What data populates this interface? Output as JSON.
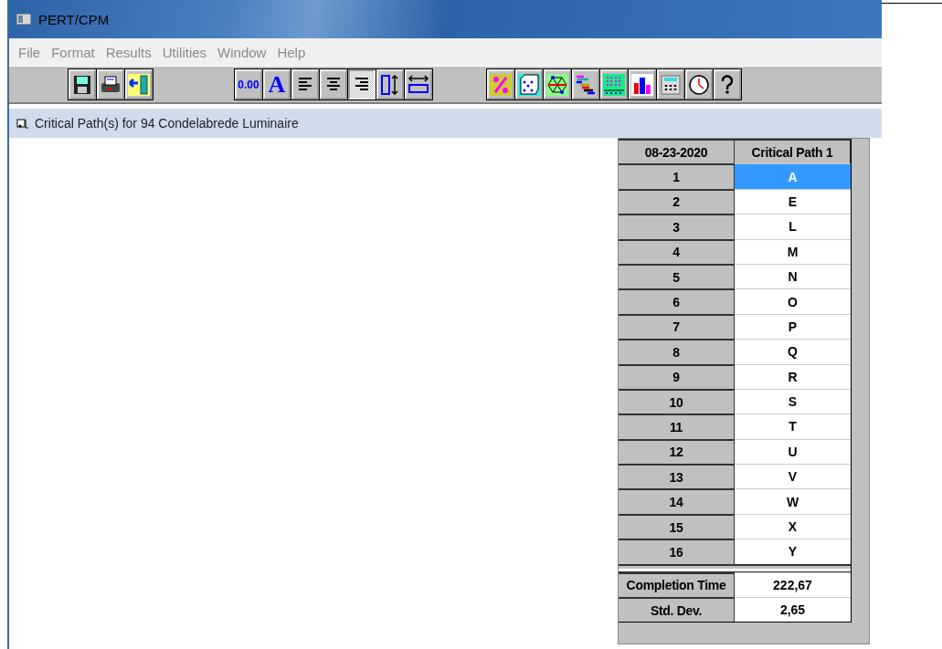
{
  "window": {
    "title": "PERT/CPM"
  },
  "menu": [
    {
      "label": "File"
    },
    {
      "label": "Format"
    },
    {
      "label": "Results"
    },
    {
      "label": "Utilities"
    },
    {
      "label": "Window"
    },
    {
      "label": "Help"
    }
  ],
  "toolbar": [
    [
      {
        "kind": "save",
        "pressed": false
      },
      {
        "kind": "print",
        "pressed": false
      },
      {
        "kind": "exit",
        "pressed": false
      }
    ],
    [
      {
        "kind": "decimals",
        "label": "0.00",
        "pressed": false
      },
      {
        "kind": "font",
        "label": "A",
        "pressed": false
      },
      {
        "kind": "align-left",
        "pressed": false
      },
      {
        "kind": "align-center",
        "pressed": false
      },
      {
        "kind": "align-right",
        "pressed": true
      },
      {
        "kind": "row-height",
        "pressed": false
      },
      {
        "kind": "column-width",
        "pressed": false
      }
    ],
    [
      {
        "kind": "percent",
        "pressed": false
      },
      {
        "kind": "dice",
        "pressed": false
      },
      {
        "kind": "network",
        "pressed": false
      },
      {
        "kind": "gantt",
        "pressed": false
      },
      {
        "kind": "grid",
        "pressed": false
      },
      {
        "kind": "bars",
        "pressed": false
      },
      {
        "kind": "calculator",
        "pressed": false
      },
      {
        "kind": "clock",
        "pressed": false
      },
      {
        "kind": "help",
        "pressed": false
      }
    ]
  ],
  "document": {
    "title": "Critical Path(s) for 94 Condelabrede Luminaire"
  },
  "table": {
    "columns": [
      "08-23-2020",
      "Critical Path 1"
    ],
    "rows": [
      {
        "number": "1",
        "activity": "A",
        "selected": true
      },
      {
        "number": "2",
        "activity": "E",
        "selected": false
      },
      {
        "number": "3",
        "activity": "L",
        "selected": false
      },
      {
        "number": "4",
        "activity": "M",
        "selected": false
      },
      {
        "number": "5",
        "activity": "N",
        "selected": false
      },
      {
        "number": "6",
        "activity": "O",
        "selected": false
      },
      {
        "number": "7",
        "activity": "P",
        "selected": false
      },
      {
        "number": "8",
        "activity": "Q",
        "selected": false
      },
      {
        "number": "9",
        "activity": "R",
        "selected": false
      },
      {
        "number": "10",
        "activity": "S",
        "selected": false
      },
      {
        "number": "11",
        "activity": "T",
        "selected": false
      },
      {
        "number": "12",
        "activity": "U",
        "selected": false
      },
      {
        "number": "13",
        "activity": "V",
        "selected": false
      },
      {
        "number": "14",
        "activity": "W",
        "selected": false
      },
      {
        "number": "15",
        "activity": "X",
        "selected": false
      },
      {
        "number": "16",
        "activity": "Y",
        "selected": false
      }
    ],
    "summary": [
      {
        "label": "Completion Time",
        "value": "222,67"
      },
      {
        "label": "Std. Dev.",
        "value": "2,65"
      }
    ]
  }
}
